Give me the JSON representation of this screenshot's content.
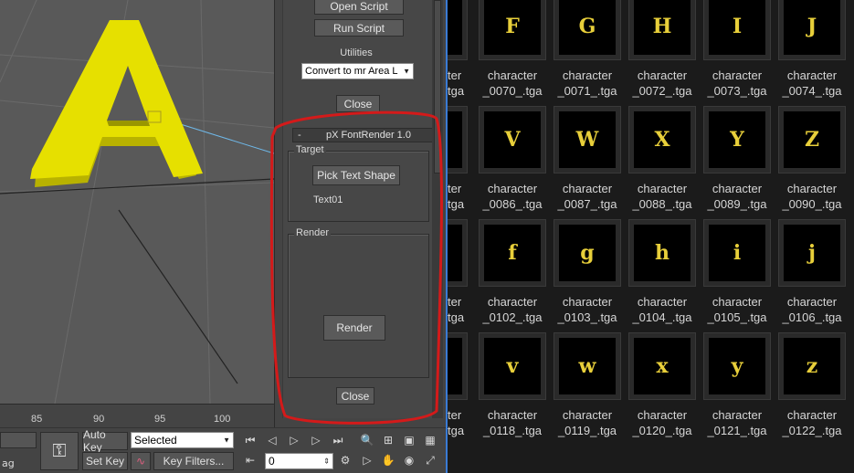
{
  "viewport": {
    "letter": "A",
    "ruler_ticks": [
      "85",
      "90",
      "95",
      "100"
    ]
  },
  "panel": {
    "open_script": "Open Script",
    "run_script": "Run Script",
    "utilities_label": "Utilities",
    "utilities_selected": "Convert to mr Area L",
    "close_top": "Close",
    "rollout_collapse": "-",
    "rollout_title": "pX FontRender 1.0",
    "target_group": "Target",
    "pick_text_shape": "Pick Text Shape",
    "target_value": "Text01",
    "render_group": "Render",
    "render_button": "Render",
    "close_bottom": "Close"
  },
  "bottom": {
    "left_partial_label": "ag",
    "auto_key": "Auto Key",
    "set_key": "Set Key",
    "selection_filter": "Selected",
    "key_filters": "Key Filters...",
    "frame_value": "0"
  },
  "browser": {
    "rows": [
      {
        "partial": [
          "ter",
          "tga"
        ],
        "items": [
          {
            "glyph": "F",
            "line1": "character",
            "line2": "_0070_.tga"
          },
          {
            "glyph": "G",
            "line1": "character",
            "line2": "_0071_.tga"
          },
          {
            "glyph": "H",
            "line1": "character",
            "line2": "_0072_.tga"
          },
          {
            "glyph": "I",
            "line1": "character",
            "line2": "_0073_.tga"
          },
          {
            "glyph": "J",
            "line1": "character",
            "line2": "_0074_.tga"
          }
        ]
      },
      {
        "partial": [
          "ter",
          "tga"
        ],
        "items": [
          {
            "glyph": "V",
            "line1": "character",
            "line2": "_0086_.tga"
          },
          {
            "glyph": "W",
            "line1": "character",
            "line2": "_0087_.tga"
          },
          {
            "glyph": "X",
            "line1": "character",
            "line2": "_0088_.tga"
          },
          {
            "glyph": "Y",
            "line1": "character",
            "line2": "_0089_.tga"
          },
          {
            "glyph": "Z",
            "line1": "character",
            "line2": "_0090_.tga"
          }
        ]
      },
      {
        "partial": [
          "ter",
          "tga"
        ],
        "items": [
          {
            "glyph": "f",
            "line1": "character",
            "line2": "_0102_.tga"
          },
          {
            "glyph": "g",
            "line1": "character",
            "line2": "_0103_.tga"
          },
          {
            "glyph": "h",
            "line1": "character",
            "line2": "_0104_.tga"
          },
          {
            "glyph": "i",
            "line1": "character",
            "line2": "_0105_.tga"
          },
          {
            "glyph": "j",
            "line1": "character",
            "line2": "_0106_.tga"
          }
        ]
      },
      {
        "partial": [
          "ter",
          "tga"
        ],
        "items": [
          {
            "glyph": "v",
            "line1": "character",
            "line2": "_0118_.tga"
          },
          {
            "glyph": "w",
            "line1": "character",
            "line2": "_0119_.tga"
          },
          {
            "glyph": "x",
            "line1": "character",
            "line2": "_0120_.tga"
          },
          {
            "glyph": "y",
            "line1": "character",
            "line2": "_0121_.tga"
          },
          {
            "glyph": "z",
            "line1": "character",
            "line2": "_0122_.tga"
          }
        ]
      }
    ]
  },
  "colors": {
    "glyph": "#e8cf3a",
    "letter_fill": "#e6e000",
    "highlight": "#d41a1a",
    "divider": "#3a7bd5"
  }
}
